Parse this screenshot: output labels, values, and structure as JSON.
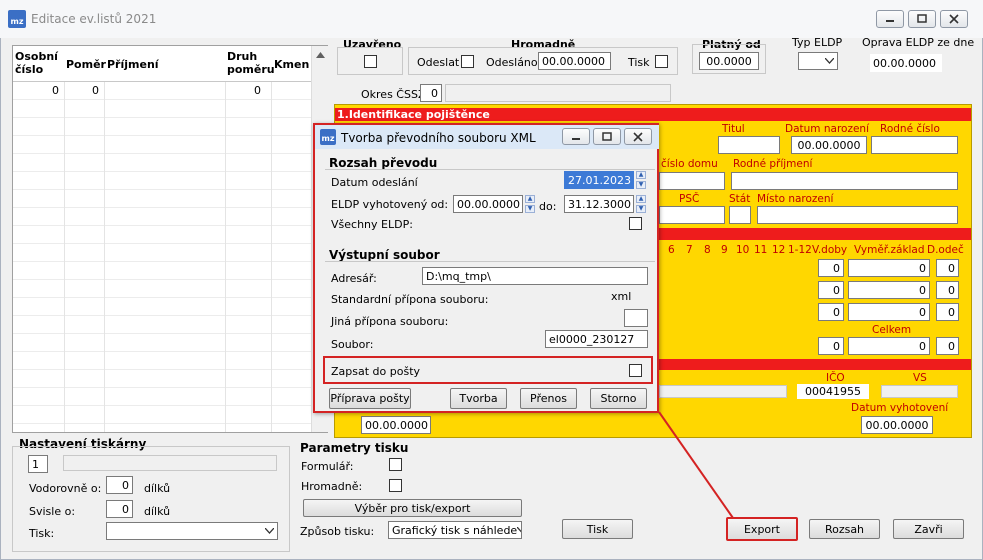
{
  "window": {
    "title": "Editace ev.listů 2021",
    "icon_label": "mz"
  },
  "table": {
    "headers": [
      "Osobní číslo",
      "Poměr",
      "Příjmení",
      "Druh poměru",
      "Kmen"
    ],
    "rows": [
      [
        "0",
        "0",
        "",
        "0",
        ""
      ]
    ]
  },
  "top": {
    "uzavreno": "Uzavřeno",
    "hromadne": "Hromadně",
    "odeslat": "Odeslat",
    "odeslano": "Odesláno",
    "odeslano_value": "00.00.0000",
    "tisk": "Tisk",
    "platny_od": "Platný od",
    "platny_od_value": "00.0000",
    "typ_eldp": "Typ ELDP",
    "oprava_eldp": "Oprava ELDP ze dne",
    "oprava_value": "00.00.0000",
    "okres": "Okres ČSSZ:",
    "okres_value": "0"
  },
  "section1": {
    "title": "1.Identifikace pojištěnce",
    "titul": "Titul",
    "datum_narozeni": "Datum narození",
    "datum_narozeni_value": "00.00.0000",
    "rodne_cislo": "Rodné číslo",
    "cislo_domu": "číslo domu",
    "rodne_prijmeni": "Rodné příjmení",
    "psc": "PSČ",
    "stat": "Stát",
    "misto_narozeni": "Místo narození"
  },
  "months": {
    "labels": [
      "6",
      "7",
      "8",
      "9",
      "10",
      "11",
      "12",
      "1-12"
    ],
    "v_doby": "V.doby",
    "vymer_zaklad": "Vyměř.základ",
    "d_odec": "D.odeč",
    "rows": [
      [
        "0",
        "0",
        "0"
      ],
      [
        "0",
        "0",
        "0"
      ],
      [
        "0",
        "0",
        "0"
      ]
    ],
    "celkem": "Celkem",
    "celkem_row": [
      "0",
      "0",
      "0"
    ]
  },
  "section_lower": {
    "ico": "IČO",
    "vs": "VS",
    "ico_value": "00041955",
    "datum_vyhotoveni": "Datum vyhotovení",
    "datum_vyhotoveni_value": "00.00.0000",
    "left_date": "00.00.0000"
  },
  "dialog": {
    "title": "Tvorba převodního souboru XML",
    "icon_label": "mz",
    "rozsah": "Rozsah převodu",
    "datum_odeslani": "Datum odeslání",
    "datum_odeslani_value": "27.01.2023",
    "eldp_od": "ELDP vyhotovený od:",
    "eldp_od_value": "00.00.0000",
    "do": "do:",
    "do_value": "31.12.3000",
    "vsechny": "Všechny ELDP:",
    "vystupni": "Výstupní soubor",
    "adresar": "Adresář:",
    "adresar_value": "D:\\mq_tmp\\",
    "std_pripona": "Standardní přípona souboru:",
    "std_pripona_value": "xml",
    "jina_pripona": "Jiná přípona souboru:",
    "soubor": "Soubor:",
    "soubor_value": "el0000_230127",
    "zapsat": "Zapsat do pošty",
    "btn_priprava": "Příprava pošty",
    "btn_tvorba": "Tvorba",
    "btn_prenos": "Přenos",
    "btn_storno": "Storno"
  },
  "printer": {
    "title": "Nastavení tiskárny",
    "number": "1",
    "vodorovne": "Vodorovně o:",
    "vodorovne_value": "0",
    "svisle": "Svisle o:",
    "svisle_value": "0",
    "dilku": "dílků",
    "tisk": "Tisk:"
  },
  "params": {
    "title": "Parametry tisku",
    "formular": "Formulář:",
    "hromadne": "Hromadně:",
    "vyber": "Výběr pro tisk/export",
    "zpusob": "Způsob tisku:",
    "zpusob_value": "Grafický tisk s náhlede"
  },
  "bottom": {
    "tisk": "Tisk",
    "export": "Export",
    "rozsah": "Rozsah",
    "zavri": "Zavři"
  },
  "colors": {
    "panel_yellow": "#ffd700",
    "section_red": "#ee1c1c",
    "highlight_red": "#d42323"
  }
}
